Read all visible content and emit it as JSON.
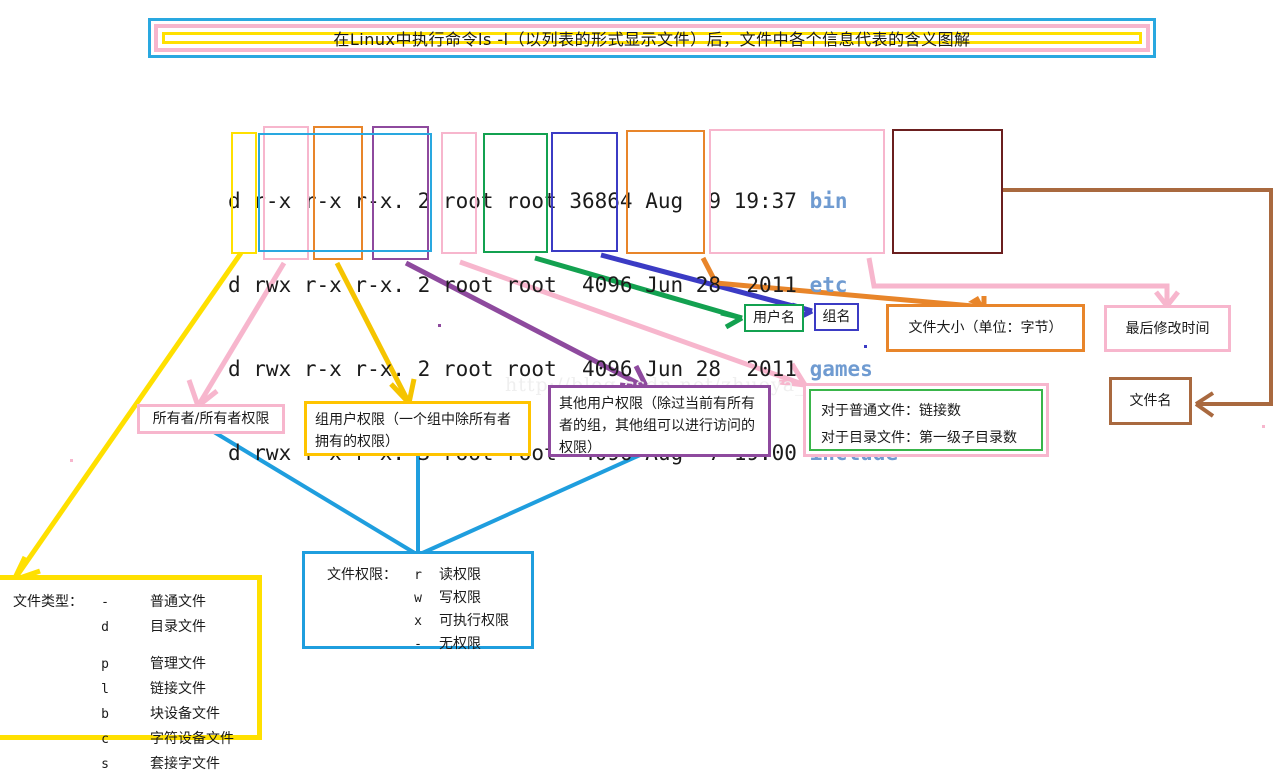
{
  "title": {
    "text": "在Linux中执行命令ls -l（以列表的形式显示文件）后，文件中各个信息代表的含义图解",
    "border_outer": "#29a8e0",
    "border_mid": "#f7b6cd",
    "border_inner": "#ffe000"
  },
  "watermark": "http://blog.csdn.net/zhuoya_",
  "listing": {
    "rows": [
      {
        "type": "d",
        "owner": "r-x",
        "group": "r-x",
        "other": "r-x.",
        "links": "2",
        "user": "root",
        "grp": "root",
        "size": "36864",
        "date": "Aug  9 19:37",
        "name": "bin"
      },
      {
        "type": "d",
        "owner": "rwx",
        "group": "r-x",
        "other": "r-x.",
        "links": "2",
        "user": "root",
        "grp": "root",
        "size": " 4096",
        "date": "Jun 28  2011",
        "name": "etc"
      },
      {
        "type": "d",
        "owner": "rwx",
        "group": "r-x",
        "other": "r-x.",
        "links": "2",
        "user": "root",
        "grp": "root",
        "size": " 4096",
        "date": "Jun 28  2011",
        "name": "games"
      },
      {
        "type": "d",
        "owner": "rwx",
        "group": "r-x",
        "other": "r-x.",
        "links": "3",
        "user": "root",
        "grp": "root",
        "size": " 4096",
        "date": "Aug  7 19:00",
        "name": "include"
      }
    ],
    "filename_color": "#6f9bd1"
  },
  "column_boxes": {
    "filetype": "#ffe000",
    "owner": "#f7b6cd",
    "group": "#e8852a",
    "other": "#8e4a9e",
    "allperms": "#29a8e0",
    "links": "#f7b6cd",
    "user": "#13a150",
    "grp": "#3b3bc4",
    "size": "#e8852a",
    "date": "#f7b6cd",
    "name": "#6b1f1f"
  },
  "labels": {
    "user_name": "用户名",
    "group_name": "组名",
    "file_size": "文件大小（单位：字节）",
    "mtime": "最后修改时间",
    "file_name": "文件名",
    "owner_perm": "所有者/所有者权限",
    "group_perm": "组用户权限（一个组中除所有者拥有的权限）",
    "other_perm": "其他用户权限（除过当前有所有者的组，其他组可以进行访问的权限）",
    "links_line1": "对于普通文件：链接数",
    "links_line2_a": "对于目录文件：",
    "links_line2_b": "第一级",
    "links_line2_c": "子目录数"
  },
  "permissions_legend": {
    "heading": "文件权限：",
    "items": [
      {
        "key": "r",
        "desc": "读权限"
      },
      {
        "key": "w",
        "desc": "写权限"
      },
      {
        "key": "x",
        "desc": "可执行权限"
      },
      {
        "key": "-",
        "desc": "无权限"
      }
    ]
  },
  "filetypes_legend": {
    "heading": "文件类型：",
    "items": [
      {
        "key": "-",
        "desc": "普通文件"
      },
      {
        "key": "d",
        "desc": "目录文件"
      },
      {
        "key": "p",
        "desc": "管理文件"
      },
      {
        "key": "l",
        "desc": "链接文件"
      },
      {
        "key": "b",
        "desc": "块设备文件"
      },
      {
        "key": "c",
        "desc": "字符设备文件"
      },
      {
        "key": "s",
        "desc": "套接字文件"
      }
    ]
  }
}
